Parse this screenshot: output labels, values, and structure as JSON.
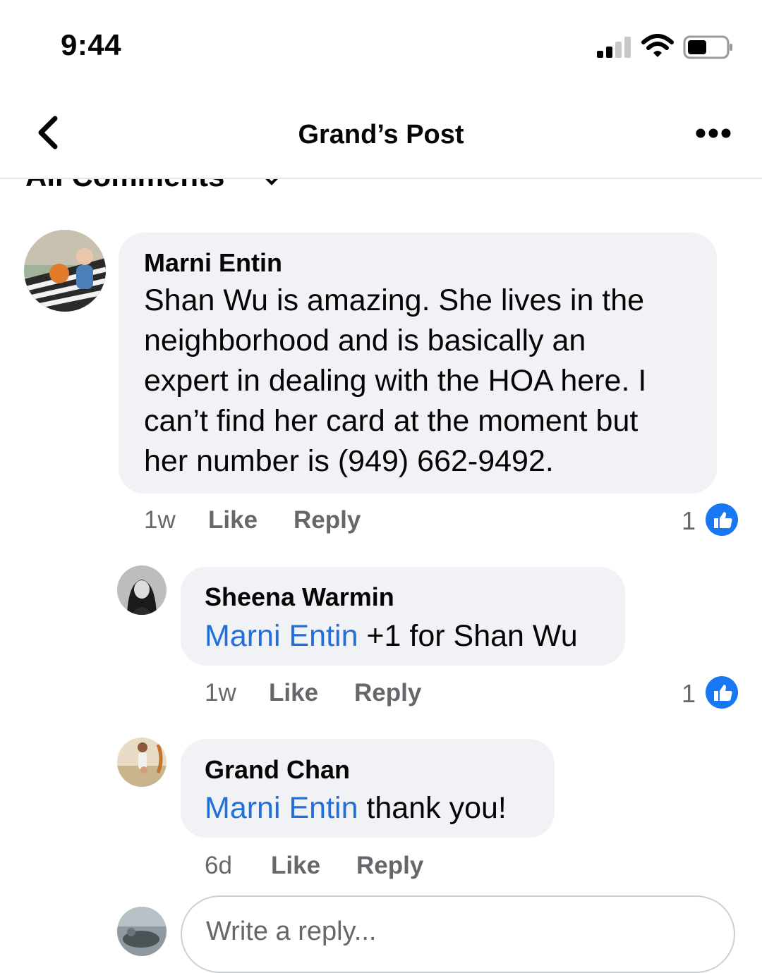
{
  "status_bar": {
    "time": "9:44"
  },
  "header": {
    "title": "Grand’s Post"
  },
  "filter": {
    "label": "All Comments"
  },
  "comments": [
    {
      "author": "Marni Entin",
      "text": "Shan Wu is amazing. She lives in the neighborhood and is basically an expert in dealing with the HOA here. I can’t find her card at the moment but her number is (949) 662-9492.",
      "lines": [
        "Shan Wu is amazing. She lives in the",
        "neighborhood and is basically an",
        "expert in dealing with the HOA here. I",
        "can’t find her card at the moment but",
        "her number is (949) 662-9492."
      ],
      "time": "1w",
      "like_label": "Like",
      "reply_label": "Reply",
      "like_count": "1"
    },
    {
      "author": "Sheena Warmin",
      "mention": "Marni Entin",
      "text": " +1 for Shan Wu",
      "time": "1w",
      "like_label": "Like",
      "reply_label": "Reply",
      "like_count": "1"
    },
    {
      "author": "Grand Chan",
      "mention": "Marni Entin",
      "text": " thank you!",
      "time": "6d",
      "like_label": "Like",
      "reply_label": "Reply"
    }
  ],
  "reply_box": {
    "placeholder": "Write a reply..."
  },
  "colors": {
    "mention": "#216fdb",
    "like_blue": "#1877f2",
    "bubble": "#f0f2f5",
    "meta": "#65676b"
  },
  "icons": [
    "back-arrow-icon",
    "more-dots-icon",
    "chevron-down-icon",
    "like-thumb-icon",
    "signal-icon",
    "wifi-icon",
    "battery-icon"
  ]
}
